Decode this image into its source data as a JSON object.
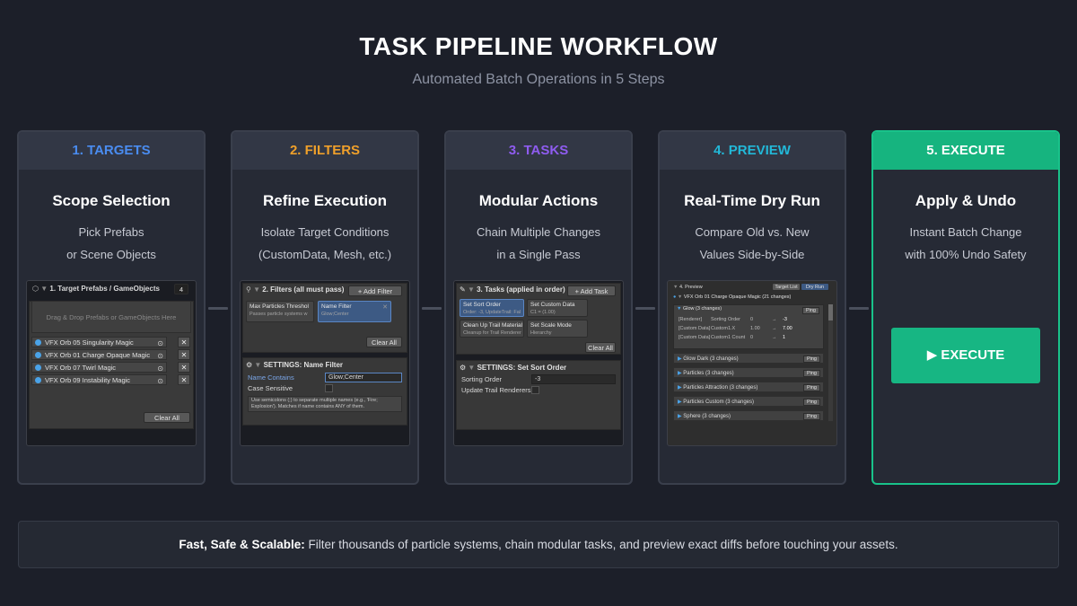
{
  "header": {
    "title": "TASK PIPELINE WORKFLOW",
    "subtitle": "Automated Batch Operations in 5 Steps"
  },
  "colors": {
    "targets": "#4a8cf0",
    "filters": "#f0a02a",
    "tasks": "#8f5cf0",
    "preview": "#22b8d8",
    "execute": "#16b47f"
  },
  "steps": [
    {
      "label": "1. TARGETS",
      "heading": "Scope Selection",
      "line1": "Pick Prefabs",
      "line2": "or Scene Objects"
    },
    {
      "label": "2. FILTERS",
      "heading": "Refine Execution",
      "line1": "Isolate Target Conditions",
      "line2": "(CustomData, Mesh, etc.)"
    },
    {
      "label": "3. TASKS",
      "heading": "Modular Actions",
      "line1": "Chain Multiple Changes",
      "line2": "in a Single Pass"
    },
    {
      "label": "4. PREVIEW",
      "heading": "Real-Time Dry Run",
      "line1": "Compare Old vs. New",
      "line2": "Values Side-by-Side"
    },
    {
      "label": "5. EXECUTE",
      "heading": "Apply & Undo",
      "line1": "Instant Batch Change",
      "line2": "with 100% Undo Safety"
    }
  ],
  "targets_panel": {
    "title": "1. Target Prefabs / GameObjects",
    "count": "4",
    "dropzone": "Drag & Drop Prefabs or GameObjects Here",
    "items": [
      "VFX Orb 05 Singularity Magic",
      "VFX Orb 01 Charge Opaque Magic",
      "VFX Orb 07 Twirl Magic",
      "VFX Orb 09 Instability Magic"
    ],
    "remove_icon": "✕",
    "clear_label": "Clear All"
  },
  "filters_panel": {
    "title": "2. Filters  (all must pass)",
    "add_label": "+ Add Filter",
    "filter1_name": "Max Particles Threshol",
    "filter1_sub": "Passes particle systems w",
    "filter2_name": "Name Filter",
    "filter2_sub": "Glow;Center",
    "clear_label": "Clear All",
    "settings_title": "SETTINGS: Name Filter",
    "name_contains_label": "Name Contains",
    "name_contains_value": "Glow;Center",
    "case_label": "Case Sensitive",
    "help": "Use semicolons (;) to separate multiple names (e.g., 'Fire; Explosion'). Matches if name contains ANY of them."
  },
  "tasks_panel": {
    "title": "3. Tasks  (applied in order)",
    "add_label": "+ Add Task",
    "tasks": [
      {
        "name": "Set Sort Order",
        "sub": "Order: -3, UpdateTrail: Fal"
      },
      {
        "name": "Set Custom Data",
        "sub": "C1 = (1.00)"
      },
      {
        "name": "Clean Up Trail Material",
        "sub": "Cleanup for Trail Renderer"
      },
      {
        "name": "Set Scale Mode",
        "sub": "Hierarchy"
      }
    ],
    "clear_label": "Clear All",
    "settings_title": "SETTINGS: Set Sort Order",
    "sorting_label": "Sorting Order",
    "sorting_value": "-3",
    "update_trail_label": "Update Trail Renderers"
  },
  "preview_panel": {
    "title": "4. Preview",
    "tab_target": "Target List",
    "tab_dry": "Dry Run",
    "root": "VFX Orb 01 Charge Opaque Magic (21 changes)",
    "glow": "Glow (3 changes)",
    "ping": "Ping",
    "changes": [
      {
        "tag": "[Renderer]",
        "prop": "Sorting Order",
        "old": "0",
        "new": "-3"
      },
      {
        "tag": "[Custom Data]",
        "prop": "Custom1.X",
        "old": "1.00",
        "new": "7.00"
      },
      {
        "tag": "[Custom Data]",
        "prop": "Custom1 Count",
        "old": "0",
        "new": "1"
      }
    ],
    "arrow": "→",
    "groups": [
      "Glow Dark (3 changes)",
      "Particles (3 changes)",
      "Particles Attraction (3 changes)",
      "Particles Custom (3 changes)",
      "Sphere (3 changes)"
    ]
  },
  "execute_panel": {
    "button_label": "EXECUTE",
    "button_icon": "play-icon"
  },
  "footer": {
    "bold": "Fast, Safe & Scalable:",
    "text": "Filter thousands of particle systems, chain modular tasks, and preview exact diffs before touching your assets."
  }
}
